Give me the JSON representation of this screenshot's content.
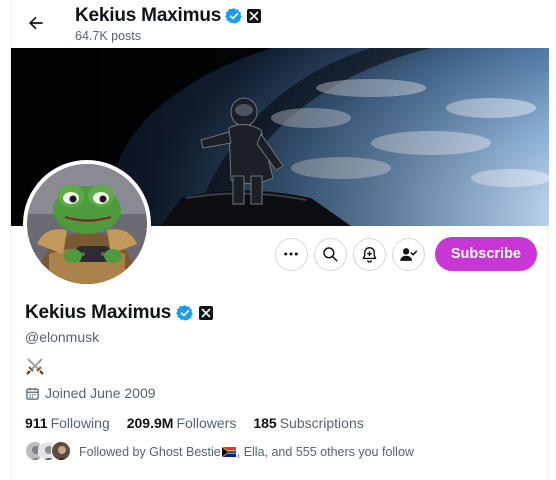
{
  "header": {
    "back_icon": "arrow-left-icon",
    "name": "Kekius Maximus",
    "posts_count": "64.7K posts"
  },
  "profile": {
    "display_name": "Kekius Maximus",
    "handle": "@elonmusk",
    "bio_icon": "crossed-swords-icon",
    "joined": "Joined June 2009",
    "verified_color": "#1d9bf0"
  },
  "actions": {
    "more_icon": "more-icon",
    "search_icon": "search-icon",
    "notify_icon": "bell-plus-icon",
    "follow_icon": "user-check-icon",
    "subscribe_label": "Subscribe",
    "subscribe_color": "#c936d6"
  },
  "stats": {
    "following_count": "911",
    "following_label": "Following",
    "followers_count": "209.9M",
    "followers_label": "Followers",
    "subscriptions_count": "185",
    "subscriptions_label": "Subscriptions"
  },
  "followed_by": {
    "text_prefix": "Followed by Ghost Bestie",
    "text_suffix": ", Ella, and 555 others you follow",
    "flag_icon": "south-africa-flag-icon"
  }
}
